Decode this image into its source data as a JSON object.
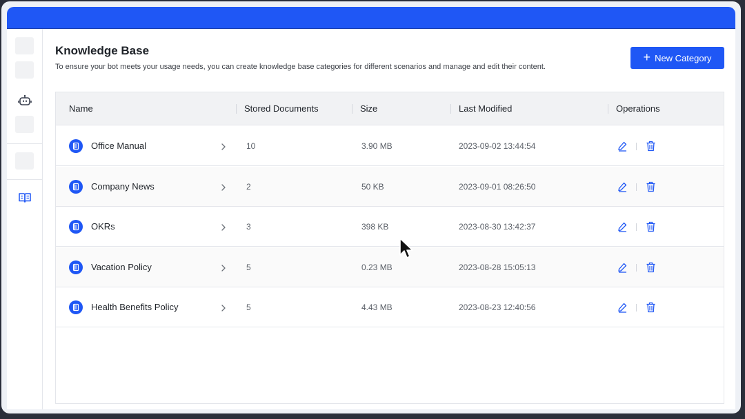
{
  "page": {
    "title": "Knowledge Base",
    "subtitle": "To ensure your bot meets your usage needs, you can create knowledge base categories for different scenarios and manage and edit their content.",
    "new_button_label": "New Category"
  },
  "sidebar": {
    "icons": [
      "robot-icon",
      "book-icon"
    ]
  },
  "table": {
    "columns": [
      "Name",
      "Stored Documents",
      "Size",
      "Last Modified",
      "Operations"
    ],
    "rows": [
      {
        "name": "Office Manual",
        "docs": "10",
        "size": "3.90 MB",
        "modified": "2023-09-02 13:44:54"
      },
      {
        "name": "Company News",
        "docs": "2",
        "size": "50 KB",
        "modified": "2023-09-01 08:26:50"
      },
      {
        "name": "OKRs",
        "docs": "3",
        "size": "398 KB",
        "modified": "2023-08-30 13:42:37"
      },
      {
        "name": "Vacation Policy",
        "docs": "5",
        "size": "0.23 MB",
        "modified": "2023-08-28 15:05:13"
      },
      {
        "name": "Health Benefits Policy",
        "docs": "5",
        "size": "4.43 MB",
        "modified": "2023-08-23 12:40:56"
      }
    ]
  },
  "colors": {
    "accent": "#1f57f5",
    "header_bg": "#f1f2f4",
    "border": "#e4e6eb"
  }
}
